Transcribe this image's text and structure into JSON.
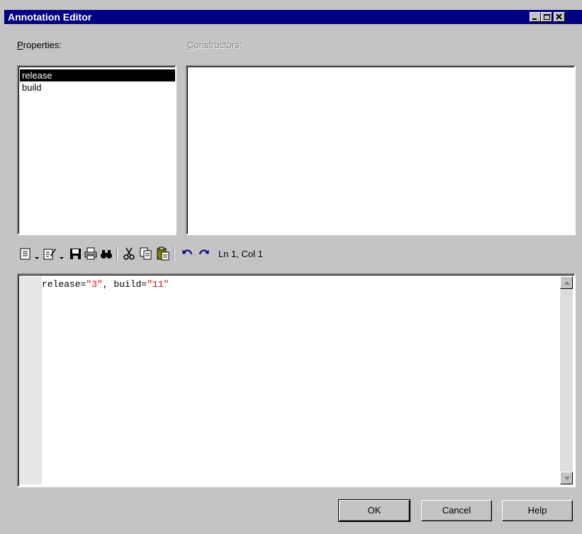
{
  "window": {
    "title": "Annotation Editor",
    "controls": {
      "minimize_icon": "minimize-icon",
      "maximize_icon": "maximize-icon",
      "close_icon": "close-icon"
    }
  },
  "properties": {
    "label_accel": "P",
    "label_rest": "roperties:",
    "items": [
      "release",
      "build"
    ],
    "selected_index": 0
  },
  "constructors": {
    "label_accel": "C",
    "label_rest": "onstructors:",
    "enabled": false
  },
  "toolbar": {
    "icons": [
      "properties-icon",
      "edit-icon",
      "save-icon",
      "print-icon",
      "find-icon",
      "cut-icon",
      "copy-icon",
      "paste-icon",
      "undo-icon",
      "redo-icon"
    ],
    "cursor_position": "Ln 1, Col 1"
  },
  "editor": {
    "part1": "release=",
    "str1": "\"3\"",
    "part2": ", build=",
    "str2": "\"11\""
  },
  "buttons": {
    "ok": "OK",
    "cancel": "Cancel",
    "help": "Help"
  },
  "colors": {
    "titlebar": "#000084",
    "dialog_face": "#c6c3c6",
    "string_literal": "#e00000",
    "selection": "#000000"
  }
}
